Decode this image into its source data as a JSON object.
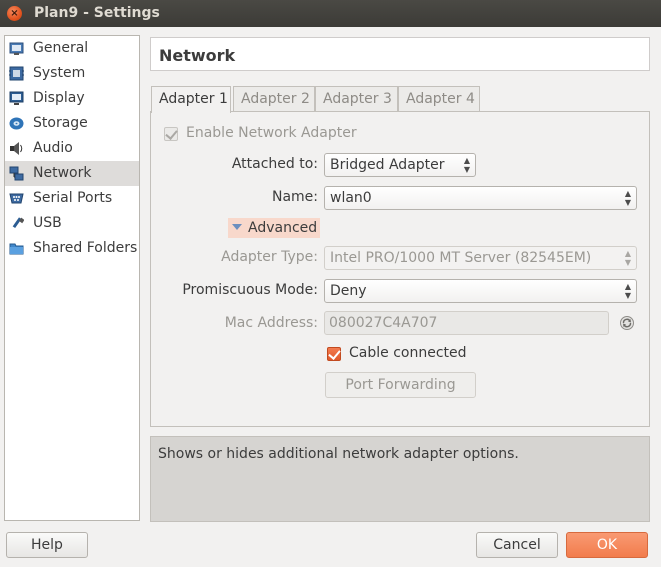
{
  "window": {
    "title": "Plan9 - Settings",
    "close_glyph": "×"
  },
  "sidebar": {
    "items": [
      {
        "label": "General",
        "icon": "general-icon"
      },
      {
        "label": "System",
        "icon": "system-icon"
      },
      {
        "label": "Display",
        "icon": "display-icon"
      },
      {
        "label": "Storage",
        "icon": "storage-icon"
      },
      {
        "label": "Audio",
        "icon": "audio-icon"
      },
      {
        "label": "Network",
        "icon": "network-icon",
        "selected": true
      },
      {
        "label": "Serial Ports",
        "icon": "serial-ports-icon"
      },
      {
        "label": "USB",
        "icon": "usb-icon"
      },
      {
        "label": "Shared Folders",
        "icon": "shared-folders-icon"
      }
    ]
  },
  "header": {
    "title": "Network"
  },
  "tabs": [
    {
      "label": "Adapter 1",
      "active": true
    },
    {
      "label": "Adapter 2"
    },
    {
      "label": "Adapter 3"
    },
    {
      "label": "Adapter 4"
    }
  ],
  "form": {
    "enable_label": "Enable Network Adapter",
    "attached_label": "Attached to:",
    "attached_value": "Bridged Adapter",
    "name_label": "Name:",
    "name_value": "wlan0",
    "advanced_label": "Advanced",
    "adapter_type_label": "Adapter Type:",
    "adapter_type_value": "Intel PRO/1000 MT Server (82545EM)",
    "promiscuous_label": "Promiscuous Mode:",
    "promiscuous_value": "Deny",
    "mac_label": "Mac Address:",
    "mac_value": "080027C4A707",
    "cable_label": "Cable connected",
    "port_forwarding_label": "Port Forwarding",
    "spin_arrows": "▲\n▼"
  },
  "info": {
    "text": "Shows or hides additional network adapter options."
  },
  "footer": {
    "help_label": "Help",
    "cancel_label": "Cancel",
    "ok_label": "OK"
  },
  "colors": {
    "accent": "#f27c4c",
    "selection": "#dedcda",
    "titlebar": "#3c3b37"
  }
}
